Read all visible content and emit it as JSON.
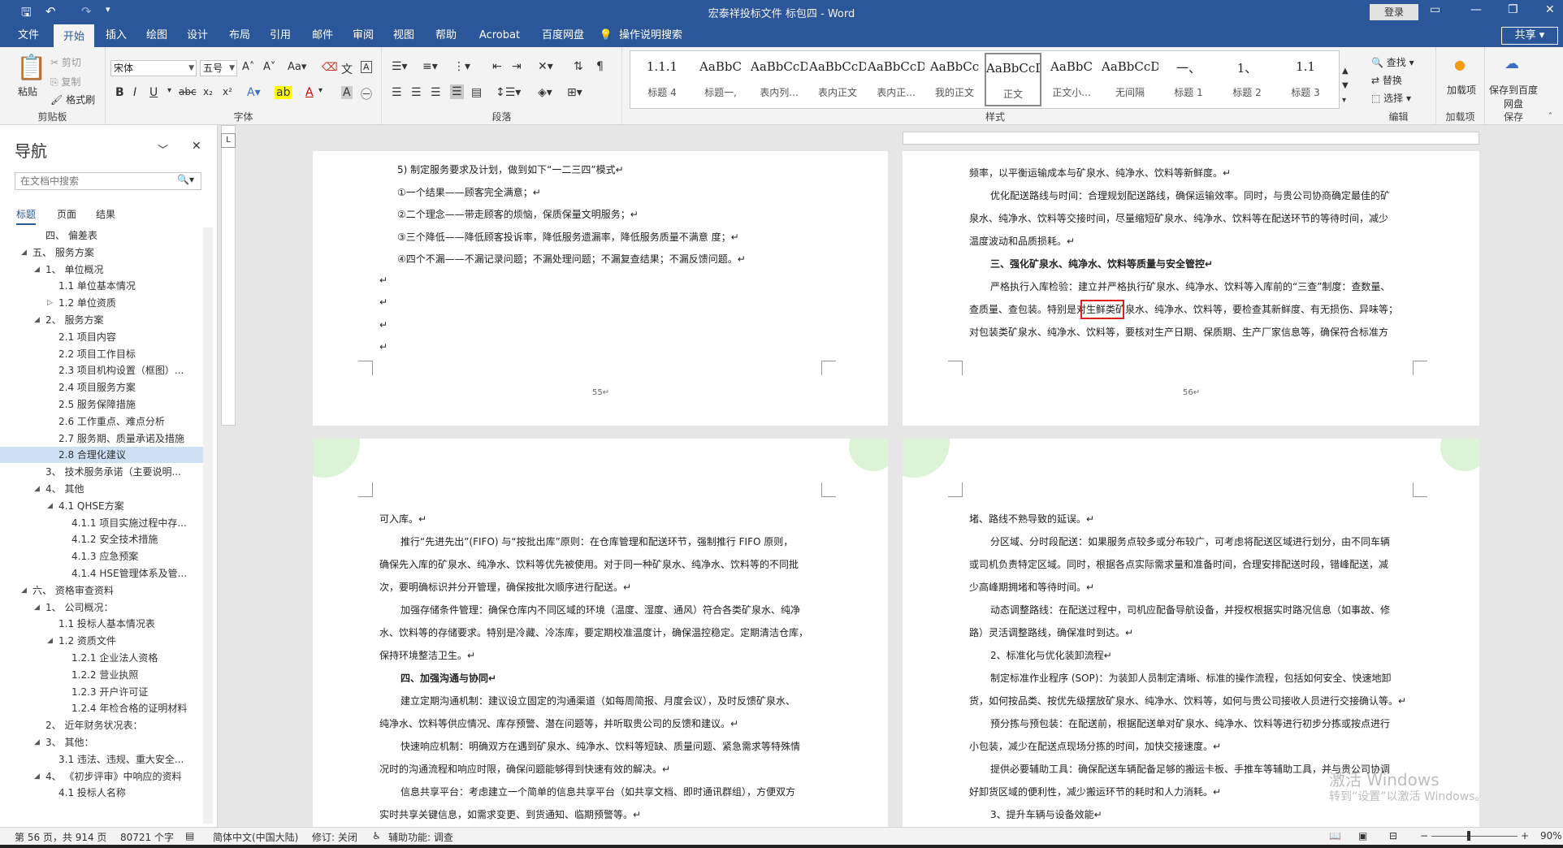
{
  "titlebar": {
    "title": "宏泰祥投标文件 标包四 - Word",
    "login": "登录",
    "save_icon": "save-icon",
    "undo_icon": "undo-icon",
    "redo_icon": "redo-icon"
  },
  "tabs": [
    "文件",
    "开始",
    "插入",
    "绘图",
    "设计",
    "布局",
    "引用",
    "邮件",
    "审阅",
    "视图",
    "帮助",
    "Acrobat",
    "百度网盘"
  ],
  "active_tab": "开始",
  "tellme": "操作说明搜索",
  "share": "共享",
  "ribbon": {
    "clipboard": {
      "paste": "粘贴",
      "cut": "剪切",
      "copy": "复制",
      "format_painter": "格式刷",
      "label": "剪贴板"
    },
    "font": {
      "name": "宋体",
      "size": "五号",
      "label": "字体"
    },
    "paragraph": {
      "label": "段落"
    },
    "styles": {
      "label": "样式",
      "items": [
        {
          "preview": "1.1.1",
          "name": "标题 4"
        },
        {
          "preview": "AaBbC",
          "name": "标题一,"
        },
        {
          "preview": "AaBbCcD",
          "name": "表内列..."
        },
        {
          "preview": "AaBbCcDd",
          "name": "表内正文"
        },
        {
          "preview": "AaBbCcDd",
          "name": "表内正..."
        },
        {
          "preview": "AaBbCc",
          "name": "我的正文"
        },
        {
          "preview": "AaBbCcDd",
          "name": "正文"
        },
        {
          "preview": "AaBbC",
          "name": "正文小..."
        },
        {
          "preview": "AaBbCcDd",
          "name": "无间隔"
        },
        {
          "preview": "一、",
          "name": "标题 1"
        },
        {
          "preview": "1、",
          "name": "标题 2"
        },
        {
          "preview": "1.1",
          "name": "标题 3"
        }
      ],
      "selected": "正文"
    },
    "editing": {
      "find": "查找",
      "replace": "替换",
      "select": "选择",
      "label": "编辑"
    },
    "addin": {
      "name": "加载项",
      "label": "加载项"
    },
    "save_baidu": {
      "name": "保存到百度网盘",
      "label": "保存"
    }
  },
  "nav": {
    "title": "导航",
    "search_placeholder": "在文档中搜索",
    "tabs": [
      "标题",
      "页面",
      "结果"
    ],
    "items": [
      {
        "text": "四、 偏差表",
        "lvl": 1,
        "arrow": ""
      },
      {
        "text": "五、 服务方案",
        "lvl": 0,
        "arrow": "◢"
      },
      {
        "text": "1、 单位概况",
        "lvl": 1,
        "arrow": "◢"
      },
      {
        "text": "1.1 单位基本情况",
        "lvl": 2,
        "arrow": ""
      },
      {
        "text": "1.2 单位资质",
        "lvl": 2,
        "arrow": "▷"
      },
      {
        "text": "2、 服务方案",
        "lvl": 1,
        "arrow": "◢"
      },
      {
        "text": "2.1 项目内容",
        "lvl": 2,
        "arrow": ""
      },
      {
        "text": "2.2 项目工作目标",
        "lvl": 2,
        "arrow": ""
      },
      {
        "text": "2.3 项目机构设置（框图）...",
        "lvl": 2,
        "arrow": ""
      },
      {
        "text": "2.4 项目服务方案",
        "lvl": 2,
        "arrow": ""
      },
      {
        "text": "2.5 服务保障措施",
        "lvl": 2,
        "arrow": ""
      },
      {
        "text": "2.6 工作重点、难点分析",
        "lvl": 2,
        "arrow": ""
      },
      {
        "text": "2.7 服务期、质量承诺及措施",
        "lvl": 2,
        "arrow": ""
      },
      {
        "text": "2.8 合理化建议",
        "lvl": 2,
        "arrow": "",
        "sel": true
      },
      {
        "text": "3、 技术服务承诺（主要说明...",
        "lvl": 1,
        "arrow": ""
      },
      {
        "text": "4、 其他",
        "lvl": 1,
        "arrow": "◢"
      },
      {
        "text": "4.1 QHSE方案",
        "lvl": 2,
        "arrow": "◢"
      },
      {
        "text": "4.1.1 项目实施过程中存...",
        "lvl": 3,
        "arrow": ""
      },
      {
        "text": "4.1.2 安全技术措施",
        "lvl": 3,
        "arrow": ""
      },
      {
        "text": "4.1.3 应急预案",
        "lvl": 3,
        "arrow": ""
      },
      {
        "text": "4.1.4 HSE管理体系及管...",
        "lvl": 3,
        "arrow": ""
      },
      {
        "text": "六、 资格审查资料",
        "lvl": 0,
        "arrow": "◢"
      },
      {
        "text": "1、 公司概况：",
        "lvl": 1,
        "arrow": "◢"
      },
      {
        "text": "1.1 投标人基本情况表",
        "lvl": 2,
        "arrow": ""
      },
      {
        "text": "1.2 资质文件",
        "lvl": 2,
        "arrow": "◢"
      },
      {
        "text": "1.2.1 企业法人资格",
        "lvl": 3,
        "arrow": ""
      },
      {
        "text": "1.2.2 营业执照",
        "lvl": 3,
        "arrow": ""
      },
      {
        "text": "1.2.3 开户许可证",
        "lvl": 3,
        "arrow": ""
      },
      {
        "text": "1.2.4 年检合格的证明材料",
        "lvl": 3,
        "arrow": ""
      },
      {
        "text": "2、 近年财务状况表：",
        "lvl": 1,
        "arrow": ""
      },
      {
        "text": "3、 其他：",
        "lvl": 1,
        "arrow": "◢"
      },
      {
        "text": "3.1 违法、违规、重大安全...",
        "lvl": 2,
        "arrow": ""
      },
      {
        "text": "4、 《初步评审》中响应的资料",
        "lvl": 1,
        "arrow": "◢"
      },
      {
        "text": "4.1 投标人名称",
        "lvl": 2,
        "arrow": ""
      }
    ]
  },
  "pages": {
    "p55": {
      "lines": [
        "5) 制定服务要求及计划，做到如下“一二三四”模式↵",
        "①一个结果——顾客完全满意；↵",
        "②二个理念——带走顾客的烦恼，保质保量文明服务；↵",
        "③三个降低——降低顾客投诉率，降低服务遗漏率，降低服务质量不满意 度；↵",
        "④四个不漏——不漏记录问题；不漏处理问题；不漏复查结果；不漏反馈问题。↵",
        "↵",
        "↵",
        "↵",
        "↵"
      ],
      "pagenum": "55↵"
    },
    "p56": {
      "lines": [
        "频率，以平衡运输成本与矿泉水、纯净水、饮料等新鲜度。↵",
        "优化配送路线与时间：合理规划配送路线，确保运输效率。同时，与贵公司协商确定最佳的矿",
        "泉水、纯净水、饮料等交接时间，尽量缩短矿泉水、纯净水、饮料等在配送环节的等待时间，减少",
        "温度波动和品质损耗。↵",
        "三、强化矿泉水、纯净水、饮料等质量与安全管控↵",
        "严格执行入库检验：建立并严格执行矿泉水、纯净水、饮料等入库前的“三查”制度：查数量、",
        "查质量、查包装。特别是对生鲜类矿泉水、纯净水、饮料等，要检查其新鲜度、有无损伤、异味等；",
        "对包装类矿泉水、纯净水、饮料等，要核对生产日期、保质期、生产厂家信息等，确保符合标准方"
      ],
      "pagenum": "56↵"
    },
    "p57": {
      "lines": [
        "可入库。↵",
        "推行“先进先出”(FIFO) 与“按批出库”原则：在仓库管理和配送环节，强制推行 FIFO 原则，",
        "确保先入库的矿泉水、纯净水、饮料等优先被使用。对于同一种矿泉水、纯净水、饮料等的不同批",
        "次，要明确标识并分开管理，确保按批次顺序进行配送。↵",
        "加强存储条件管理：确保仓库内不同区域的环境（温度、湿度、通风）符合各类矿泉水、纯净",
        "水、饮料等的存储要求。特别是冷藏、冷冻库，要定期校准温度计，确保温控稳定。定期清洁仓库，",
        "保持环境整洁卫生。↵",
        "四、加强沟通与协同↵",
        "建立定期沟通机制：建议设立固定的沟通渠道（如每周简报、月度会议），及时反馈矿泉水、",
        "纯净水、饮料等供应情况、库存预警、潜在问题等，并听取贵公司的反馈和建议。↵",
        "快速响应机制：明确双方在遇到矿泉水、纯净水、饮料等短缺、质量问题、紧急需求等特殊情",
        "况时的沟通流程和响应时限，确保问题能够得到快速有效的解决。↵",
        "信息共享平台：考虑建立一个简单的信息共享平台（如共享文档、即时通讯群组），方便双方",
        "实时共享关键信息，如需求变更、到货通知、临期预警等。↵"
      ]
    },
    "p58": {
      "lines": [
        "堵、路线不熟导致的延误。↵",
        "分区域、分时段配送：如果服务点较多或分布较广，可考虑将配送区域进行划分，由不同车辆",
        "或司机负责特定区域。同时，根据各点实际需求量和准备时间，合理安排配送时段，错峰配送，减",
        "少高峰期拥堵和等待时间。↵",
        "动态调整路线：在配送过程中，司机应配备导航设备，并授权根据实时路况信息（如事故、修",
        "路）灵活调整路线，确保准时到达。↵",
        "2、标准化与优化装卸流程↵",
        "制定标准作业程序 (SOP)：为装卸人员制定清晰、标准的操作流程，包括如何安全、快速地卸",
        "货，如何按品类、按优先级摆放矿泉水、纯净水、饮料等，如何与贵公司接收人员进行交接确认等。↵",
        "预分拣与预包装：在配送前，根据配送单对矿泉水、纯净水、饮料等进行初步分拣或按点进行",
        "小包装，减少在配送点现场分拣的时间，加快交接速度。↵",
        "提供必要辅助工具：确保配送车辆配备足够的搬运卡板、手推车等辅助工具，并与贵公司协调",
        "好卸货区域的便利性，减少搬运环节的耗时和人力消耗。↵",
        "3、提升车辆与设备效能↵"
      ]
    }
  },
  "status": {
    "page": "第 56 页，共 914 页",
    "words": "80721 个字",
    "lang": "简体中文(中国大陆)",
    "track": "修订: 关闭",
    "access": "辅助功能: 调查",
    "zoom": "90%"
  },
  "watermark": {
    "line1": "激活 Windows",
    "line2": "转到“设置”以激活 Windows。"
  }
}
